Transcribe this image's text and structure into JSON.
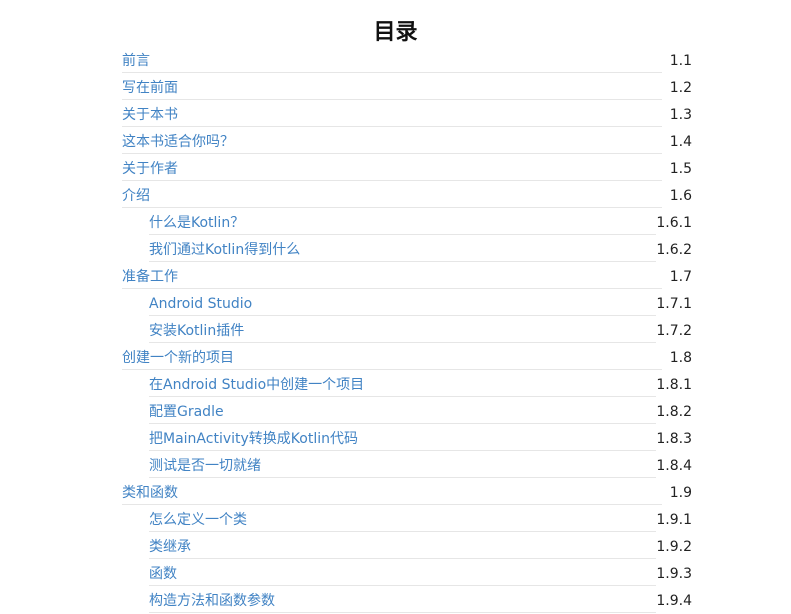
{
  "title": "目录",
  "entries": [
    {
      "label": "前言",
      "num": "1.1",
      "level": 1
    },
    {
      "label": "写在前面",
      "num": "1.2",
      "level": 1
    },
    {
      "label": "关于本书",
      "num": "1.3",
      "level": 1
    },
    {
      "label": "这本书适合你吗？",
      "num": "1.4",
      "level": 1
    },
    {
      "label": "关于作者",
      "num": "1.5",
      "level": 1
    },
    {
      "label": "介绍",
      "num": "1.6",
      "level": 1
    },
    {
      "label": "什么是Kotlin？",
      "num": "1.6.1",
      "level": 2
    },
    {
      "label": "我们通过Kotlin得到什么",
      "num": "1.6.2",
      "level": 2
    },
    {
      "label": "准备工作",
      "num": "1.7",
      "level": 1
    },
    {
      "label": "Android Studio",
      "num": "1.7.1",
      "level": 2
    },
    {
      "label": "安装Kotlin插件",
      "num": "1.7.2",
      "level": 2
    },
    {
      "label": "创建一个新的项目",
      "num": "1.8",
      "level": 1
    },
    {
      "label": "在Android Studio中创建一个项目",
      "num": "1.8.1",
      "level": 2
    },
    {
      "label": "配置Gradle",
      "num": "1.8.2",
      "level": 2
    },
    {
      "label": "把MainActivity转换成Kotlin代码",
      "num": "1.8.3",
      "level": 2
    },
    {
      "label": "测试是否一切就绪",
      "num": "1.8.4",
      "level": 2
    },
    {
      "label": "类和函数",
      "num": "1.9",
      "level": 1
    },
    {
      "label": "怎么定义一个类",
      "num": "1.9.1",
      "level": 2
    },
    {
      "label": "类继承",
      "num": "1.9.2",
      "level": 2
    },
    {
      "label": "函数",
      "num": "1.9.3",
      "level": 2
    },
    {
      "label": "构造方法和函数参数",
      "num": "1.9.4",
      "level": 2
    }
  ]
}
